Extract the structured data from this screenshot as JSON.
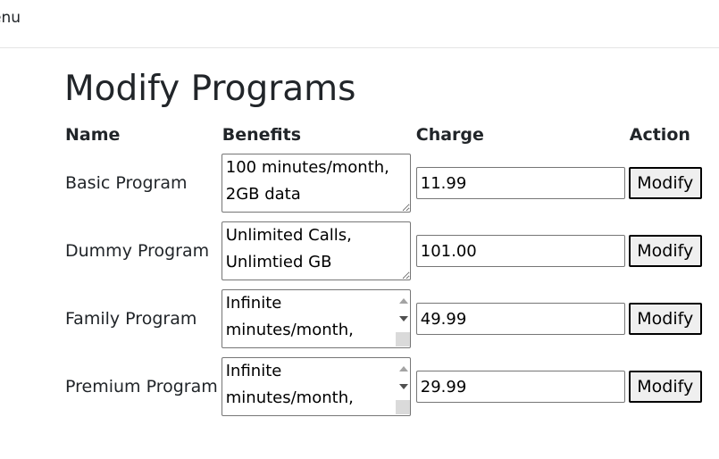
{
  "nav": {
    "menu_label": "enu"
  },
  "page": {
    "title": "Modify Programs"
  },
  "table": {
    "headers": {
      "name": "Name",
      "benefits": "Benefits",
      "charge": "Charge",
      "action": "Action"
    },
    "rows": [
      {
        "name": "Basic Program",
        "benefits": "100 minutes/month, 2GB data",
        "charge": "11.99",
        "action_label": "Modify",
        "has_scrollbar": false
      },
      {
        "name": "Dummy Program",
        "benefits": "Unlimited Calls, Unlimtied GB",
        "charge": "101.00",
        "action_label": "Modify",
        "has_scrollbar": false
      },
      {
        "name": "Family Program",
        "benefits": "Infinite minutes/month,",
        "charge": "49.99",
        "action_label": "Modify",
        "has_scrollbar": true
      },
      {
        "name": "Premium Program",
        "benefits": "Infinite minutes/month,",
        "charge": "29.99",
        "action_label": "Modify",
        "has_scrollbar": true
      }
    ]
  }
}
